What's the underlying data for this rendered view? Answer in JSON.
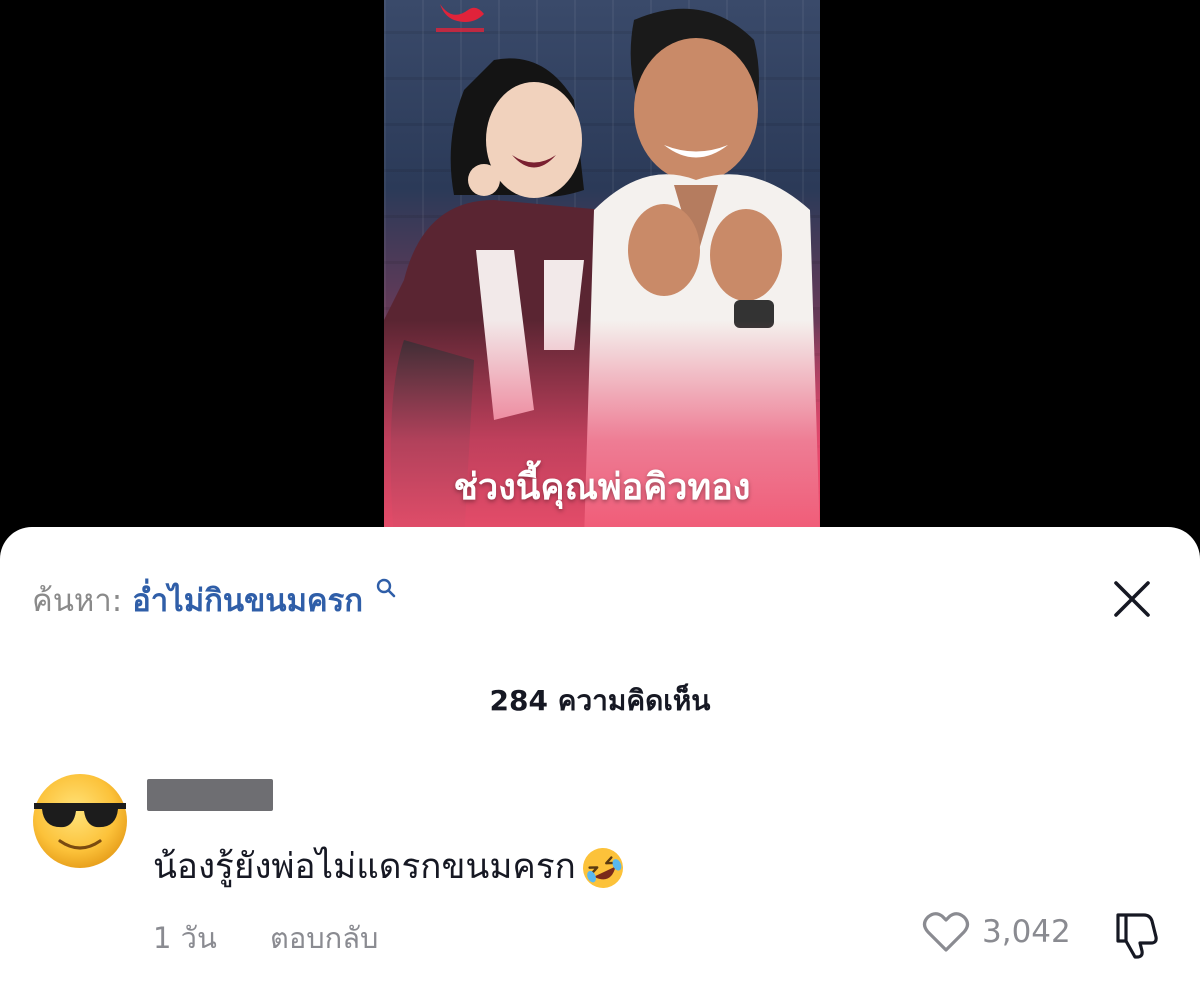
{
  "video": {
    "caption": "ช่วงนี้คุณพ่อคิวทอง"
  },
  "search": {
    "prefix": "ค้นหา:",
    "term": "อ่ำไม่กินขนมครก",
    "icon": "search-icon"
  },
  "comments_header": {
    "count_label": "284 ความคิดเห็น"
  },
  "comment": {
    "avatar_icon": "sunglasses-emoji-avatar",
    "text": "น้องรู้ยังพ่อไม่แดรกขนมครก",
    "emoji": "rofl-emoji-icon",
    "age": "1 วัน",
    "reply_label": "ตอบกลับ",
    "like_count": "3,042"
  },
  "colors": {
    "link_blue": "#2f5ea8",
    "text_dark": "#161823",
    "text_gray": "#8a8b91",
    "sheet_bg": "#ffffff"
  }
}
